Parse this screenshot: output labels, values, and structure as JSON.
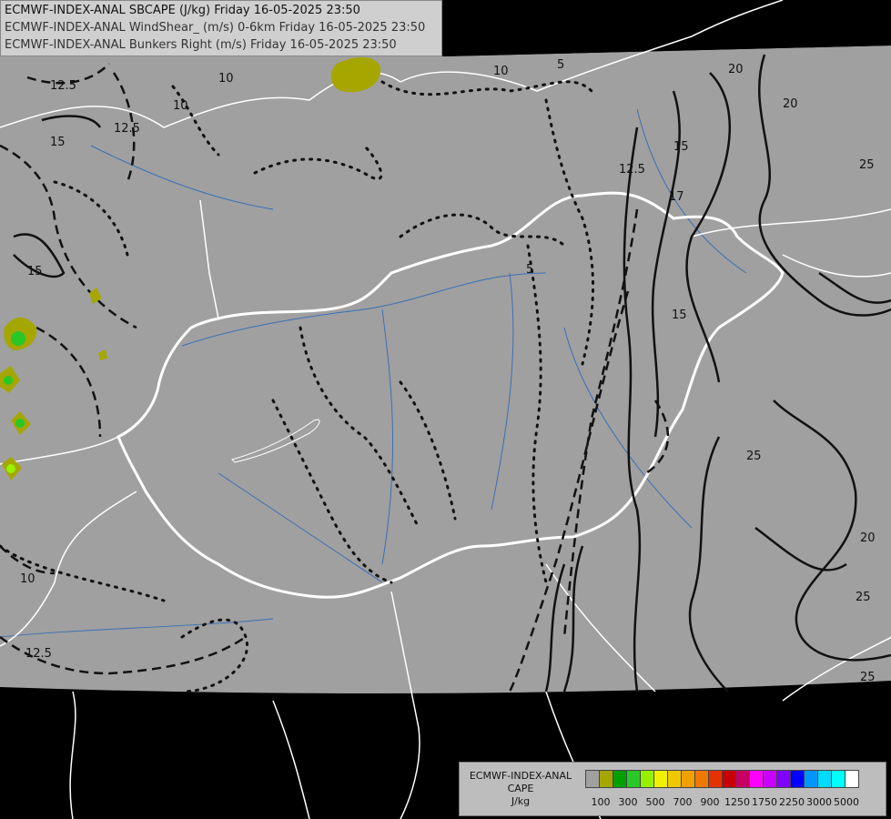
{
  "header": {
    "line1": "ECMWF-INDEX-ANAL SBCAPE (J/kg) Friday 16-05-2025 23:50",
    "line2": "ECMWF-INDEX-ANAL WindShear_ (m/s) 0-6km Friday 16-05-2025 23:50",
    "line3": "ECMWF-INDEX-ANAL Bunkers Right (m/s) Friday 16-05-2025 23:50"
  },
  "legend": {
    "title_line1": "ECMWF-INDEX-ANAL",
    "title_line2": "CAPE",
    "title_line3": "J/kg",
    "colors": [
      "#a0a0a0",
      "#a6a600",
      "#00a000",
      "#28c828",
      "#96f000",
      "#f0f000",
      "#f0c800",
      "#f0a000",
      "#f07800",
      "#e63200",
      "#c80000",
      "#c80064",
      "#ff00ff",
      "#c800ff",
      "#8200ff",
      "#0000ff",
      "#0096ff",
      "#00dcff",
      "#00ffff",
      "#ffffff"
    ],
    "tick_labels": [
      "100",
      "300",
      "500",
      "700",
      "900",
      "1250",
      "1750",
      "2250",
      "3000",
      "5000"
    ]
  },
  "contour_labels": [
    "12.5",
    "10",
    "12.5",
    "15",
    "10",
    "5",
    "10",
    "12.5",
    "15",
    "20",
    "20",
    "15",
    "17",
    "25",
    "5",
    "15",
    "25",
    "20",
    "25",
    "25",
    "10",
    "12.5"
  ]
}
